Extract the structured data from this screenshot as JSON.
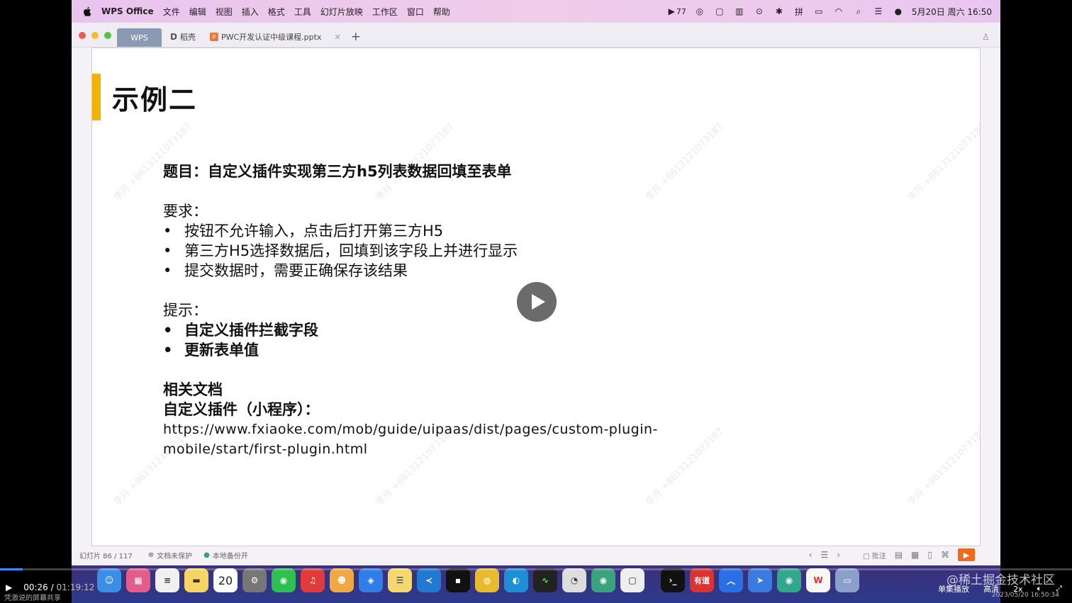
{
  "menubar": {
    "app_name": "WPS Office",
    "items": [
      "文件",
      "编辑",
      "视图",
      "插入",
      "格式",
      "工具",
      "幻灯片放映",
      "工作区",
      "窗口",
      "帮助"
    ],
    "status_count": "77",
    "datetime": "5月20日 周六 16:50"
  },
  "tabs": {
    "wps_label": "WPS",
    "tab2_label": "稻壳",
    "doc_label": "PWC开发认证中级课程.pptx"
  },
  "slide": {
    "title": "示例二",
    "question": "题目：自定义插件实现第三方h5列表数据回填至表单",
    "requirements_label": "要求：",
    "requirements": [
      "按钮不允许输入，点击后打开第三方H5",
      "第三方H5选择数据后，回填到该字段上并进行显示",
      "提交数据时，需要正确保存该结果"
    ],
    "hints_label": "提示：",
    "hints": [
      "自定义插件拦截字段",
      "更新表单值"
    ],
    "docs_label": "相关文档",
    "docs_sub": "自定义插件（小程序）：",
    "url_line1": "https://www.fxiaoke.com/mob/guide/uipaas/dist/pages/custom-plugin-",
    "url_line2": "mobile/start/first-plugin.html",
    "watermark": "李月 +8613121073187"
  },
  "statusbar": {
    "slide_counter": "幻灯片 86 / 117",
    "protect": "文档未保护",
    "backup": "本地备份开",
    "annotate": "批注"
  },
  "dock": {
    "calendar_day": "20"
  },
  "player": {
    "current": "00:26",
    "total": "01:19:12",
    "sharing": "凭激说的屏幕共享",
    "playlist": "单集播放",
    "quality": "高清",
    "speed": "2x",
    "watermark": "@稀土掘金技术社区",
    "timestamp": "2023/05/20 16:50:34",
    "progress_fraction": 0.006
  }
}
